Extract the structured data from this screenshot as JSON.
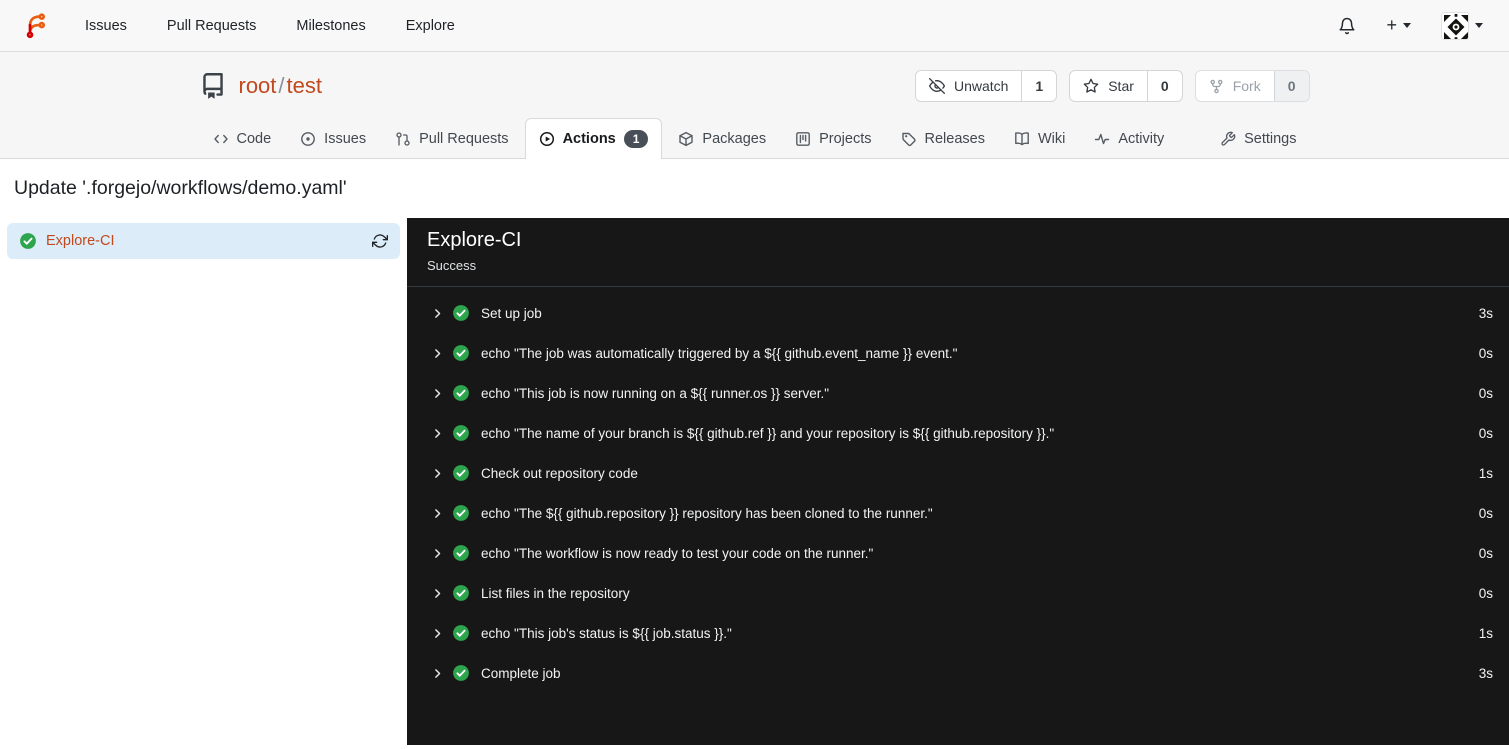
{
  "colors": {
    "primary_link": "#c2491d",
    "success_green": "#2da44e",
    "panel_bg": "#171717",
    "selected_job_bg": "#dcedf9",
    "badge_bg": "#484f58"
  },
  "icons": {
    "forgejo-logo": "orange/red branch glyph",
    "bell-icon": "notification bell outline",
    "plus-icon": "+",
    "avatar": "black-and-white identicon",
    "repo-book-icon": "repository book with bookmark",
    "eye-slash-icon": "crossed eye (unwatch)",
    "star-icon": "star outline",
    "fork-icon": "git fork",
    "code-icon": "angle brackets",
    "issue-icon": "circled dot",
    "pull-request-icon": "git pull request",
    "play-circle-icon": "play in circle",
    "package-icon": "cube",
    "project-icon": "project board",
    "tag-icon": "release tag",
    "book-icon": "open book (wiki)",
    "pulse-icon": "activity pulse line",
    "tools-icon": "wrench (settings)",
    "refresh-icon": "circular arrows",
    "chevron-right-icon": "right chevron",
    "check-circle-icon": "green circle with white check"
  },
  "navbar": {
    "links": {
      "issues": "Issues",
      "pulls": "Pull Requests",
      "milestones": "Milestones",
      "explore": "Explore"
    },
    "plus": "+"
  },
  "repo": {
    "owner": "root",
    "separator": "/",
    "name": "test"
  },
  "repo_actions": {
    "unwatch": {
      "label": "Unwatch",
      "count": "1"
    },
    "star": {
      "label": "Star",
      "count": "0"
    },
    "fork": {
      "label": "Fork",
      "count": "0"
    }
  },
  "tabs": {
    "code": "Code",
    "issues": "Issues",
    "pulls": "Pull Requests",
    "actions": "Actions",
    "actions_badge": "1",
    "packages": "Packages",
    "projects": "Projects",
    "releases": "Releases",
    "wiki": "Wiki",
    "activity": "Activity",
    "settings": "Settings"
  },
  "page": {
    "title": "Update '.forgejo/workflows/demo.yaml'"
  },
  "sidebar": {
    "job_name": "Explore-CI"
  },
  "panel": {
    "job_name": "Explore-CI",
    "status": "Success",
    "steps": [
      {
        "label": "Set up job",
        "duration": "3s"
      },
      {
        "label": "echo \"The job was automatically triggered by a ${{ github.event_name }} event.\"",
        "duration": "0s"
      },
      {
        "label": "echo \"This job is now running on a ${{ runner.os }} server.\"",
        "duration": "0s"
      },
      {
        "label": "echo \"The name of your branch is ${{ github.ref }} and your repository is ${{ github.repository }}.\"",
        "duration": "0s"
      },
      {
        "label": "Check out repository code",
        "duration": "1s"
      },
      {
        "label": "echo \"The ${{ github.repository }} repository has been cloned to the runner.\"",
        "duration": "0s"
      },
      {
        "label": "echo \"The workflow is now ready to test your code on the runner.\"",
        "duration": "0s"
      },
      {
        "label": "List files in the repository",
        "duration": "0s"
      },
      {
        "label": "echo \"This job's status is ${{ job.status }}.\"",
        "duration": "1s"
      },
      {
        "label": "Complete job",
        "duration": "3s"
      }
    ]
  }
}
